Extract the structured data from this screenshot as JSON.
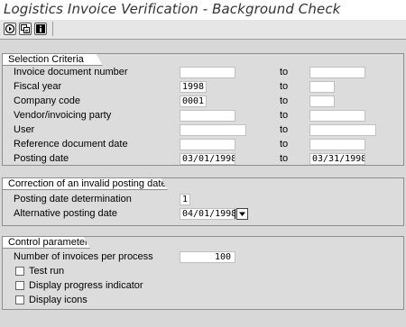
{
  "window": {
    "title": "Logistics Invoice Verification - Background Check"
  },
  "toolbar": {
    "buttons": [
      {
        "icon": "execute-icon"
      },
      {
        "icon": "variant-icon"
      },
      {
        "icon": "info-icon"
      }
    ]
  },
  "selection_criteria": {
    "title": "Selection Criteria",
    "to_label": "to",
    "rows": [
      {
        "label": "Invoice document number",
        "from": "",
        "to": ""
      },
      {
        "label": "Fiscal year",
        "from": "1998",
        "to": ""
      },
      {
        "label": "Company code",
        "from": "0001",
        "to": ""
      },
      {
        "label": "Vendor/invoicing party",
        "from": "",
        "to": ""
      },
      {
        "label": "User",
        "from": "",
        "to": ""
      },
      {
        "label": "Reference document date",
        "from": "",
        "to": ""
      },
      {
        "label": "Posting date",
        "from": "03/01/1998",
        "to": "03/31/1998"
      }
    ]
  },
  "correction": {
    "title": "Correction of an invalid posting date",
    "determination_label": "Posting date determination",
    "determination_value": "1",
    "alt_date_label": "Alternative posting date",
    "alt_date_value": "04/01/1998"
  },
  "control": {
    "title": "Control parameters",
    "invoices_label": "Number of invoices per process",
    "invoices_value": "100",
    "checkboxes": [
      {
        "label": "Test run",
        "checked": false
      },
      {
        "label": "Display progress indicator",
        "checked": false
      },
      {
        "label": "Display icons",
        "checked": false
      }
    ]
  }
}
